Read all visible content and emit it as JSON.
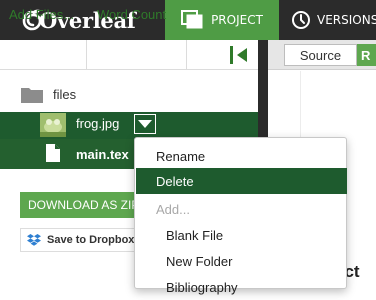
{
  "topbar": {
    "logo_text": "Overleaf",
    "project_tab": "PROJECT",
    "versions_tab": "VERSIONS",
    "project_icon": "projects-icon",
    "versions_icon": "clock-icon",
    "accent_color": "#4f9c45"
  },
  "toolbar": {
    "add_files": "Add Files...",
    "word_count": "Word Count",
    "collapse_icon": "collapse-panel-icon"
  },
  "editor": {
    "source_label": "Source",
    "rich_label": "R",
    "contact_text": "act"
  },
  "file_tree": {
    "root_label": "files",
    "items": [
      {
        "name": "frog.jpg",
        "icon": "image-thumbnail"
      },
      {
        "name": "main.tex",
        "icon": "document-icon"
      }
    ],
    "selected_color": "#1e5b2e"
  },
  "actions": {
    "download": "DOWNLOAD AS ZIP",
    "dropbox": "Save to Dropbox"
  },
  "context_menu": {
    "items": [
      {
        "label": "Rename",
        "state": "normal"
      },
      {
        "label": "Delete",
        "state": "highlighted"
      },
      {
        "label": "Add...",
        "state": "disabled"
      },
      {
        "label": "Blank File",
        "state": "normal"
      },
      {
        "label": "New Folder",
        "state": "normal"
      },
      {
        "label": "Bibliography",
        "state": "normal"
      }
    ]
  }
}
